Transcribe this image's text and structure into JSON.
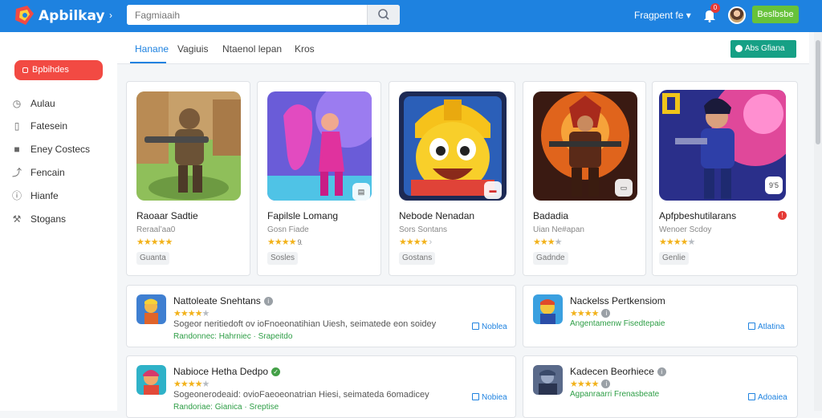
{
  "header": {
    "brand": "Apbilkay",
    "search_placeholder": "Fagmiaaih",
    "top_link": "Fragpent fe",
    "notification_count": "0",
    "cta_label": "Beslbsbe"
  },
  "sidebar": {
    "primary_button": "Bpbihdes",
    "items": [
      {
        "label": "Aulau",
        "icon": "clock-icon"
      },
      {
        "label": "Fatesein",
        "icon": "building-icon"
      },
      {
        "label": "Eney Costecs",
        "icon": "grid-icon"
      },
      {
        "label": "Fencain",
        "icon": "chart-icon"
      },
      {
        "label": "Hianfe",
        "icon": "info-icon"
      },
      {
        "label": "Stogans",
        "icon": "tools-icon"
      }
    ]
  },
  "tabs": [
    {
      "label": "Hanane",
      "active": true
    },
    {
      "label": "Vagiuis",
      "active": false
    },
    {
      "label": "Ntaenol lepan",
      "active": false
    },
    {
      "label": "Kros",
      "active": false
    }
  ],
  "filter_button": "Abs Gfiana",
  "featured": [
    {
      "name": "Raoaar Sadtie",
      "developer": "Reraal’aa0",
      "rating": 4.5,
      "tag": "Guanta",
      "corner": "",
      "badge": false
    },
    {
      "name": "Fapilsle Lomang",
      "developer": "Gosn Fiade",
      "rating": 3.5,
      "rating_suffix": "9.",
      "tag": "Sosles",
      "corner": "app-icon",
      "badge": false
    },
    {
      "name": "Nebode Nenadan",
      "developer": "Sors Sontans",
      "rating": 3.5,
      "tag": "Gostans",
      "corner": "flag-icon",
      "badge": false
    },
    {
      "name": "Badadia",
      "developer": "Uian Ne#apan",
      "rating": 3,
      "tag": "Gadnde",
      "corner": "app-icon",
      "badge": false
    },
    {
      "name": "Apfpbeshutilarans",
      "developer": "Wenoer Scdoy",
      "rating": 4,
      "tag": "Genlie",
      "corner": "",
      "corner_text": "9’5",
      "badge": true
    }
  ],
  "list": [
    {
      "title": "Nattoleate Snehtans",
      "info": "gray",
      "rating": 3.5,
      "description": "Sogeor neritiedoft ov ioFnoeonatihian Uiesh, seimatede eon soidey",
      "categories": "Randonnec: Hahrniec · Srapeitdo",
      "action": "Noblea"
    },
    {
      "title": "Nackelss Pertkensiom",
      "info": "gray",
      "rating": 3.5,
      "description": "",
      "categories": "Angentamenw Fisedtepaie",
      "action": "Atlatina"
    },
    {
      "title": "Nabioce Hetha Dedpo",
      "info": "green",
      "rating": 3.5,
      "description": "Sogeonerodeaid: ovioFaeoeonatrian Hiesi, seimateda 6omadicey",
      "categories": "Randoriae: Gianica · Sreptise",
      "action": "Nobiea"
    },
    {
      "title": "Kadecen Beorhiece",
      "info": "gray",
      "rating": 3.5,
      "description": "",
      "categories": "Agpanraarri Frenasbeate",
      "action": "Adoaiea"
    }
  ],
  "colors": {
    "primary": "#1e82e0",
    "danger": "#f24a43",
    "success": "#67c23a",
    "teal": "#16a085",
    "star": "#f2b21b"
  }
}
